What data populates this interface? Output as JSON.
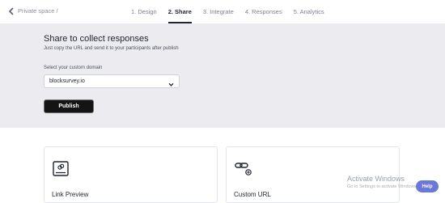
{
  "nav": {
    "breadcrumb": "Private space /",
    "steps": [
      {
        "label": "1. Design"
      },
      {
        "label": "2. Share"
      },
      {
        "label": "3. Integrate"
      },
      {
        "label": "4. Responses"
      },
      {
        "label": "5. Analytics"
      }
    ],
    "active_step": "2. Share"
  },
  "share": {
    "title": "Share to collect responses",
    "subtitle": "Just copy the URL and send it to your participants after publish",
    "domain_label": "Select your custom domain",
    "domain_value": "blocksurvey.io",
    "publish_label": "Publish"
  },
  "cards": [
    {
      "label": "Link Preview",
      "icon": "link-preview-icon"
    },
    {
      "label": "Custom URL",
      "icon": "custom-url-icon"
    }
  ],
  "watermark": {
    "title": "Activate Windows",
    "subtitle": "Go to Settings to activate Windows."
  },
  "help": {
    "label": "Help"
  },
  "colors": {
    "panel_bg": "#ebebf0",
    "publish_bg": "#141414",
    "help_bg": "#6b78d6"
  }
}
